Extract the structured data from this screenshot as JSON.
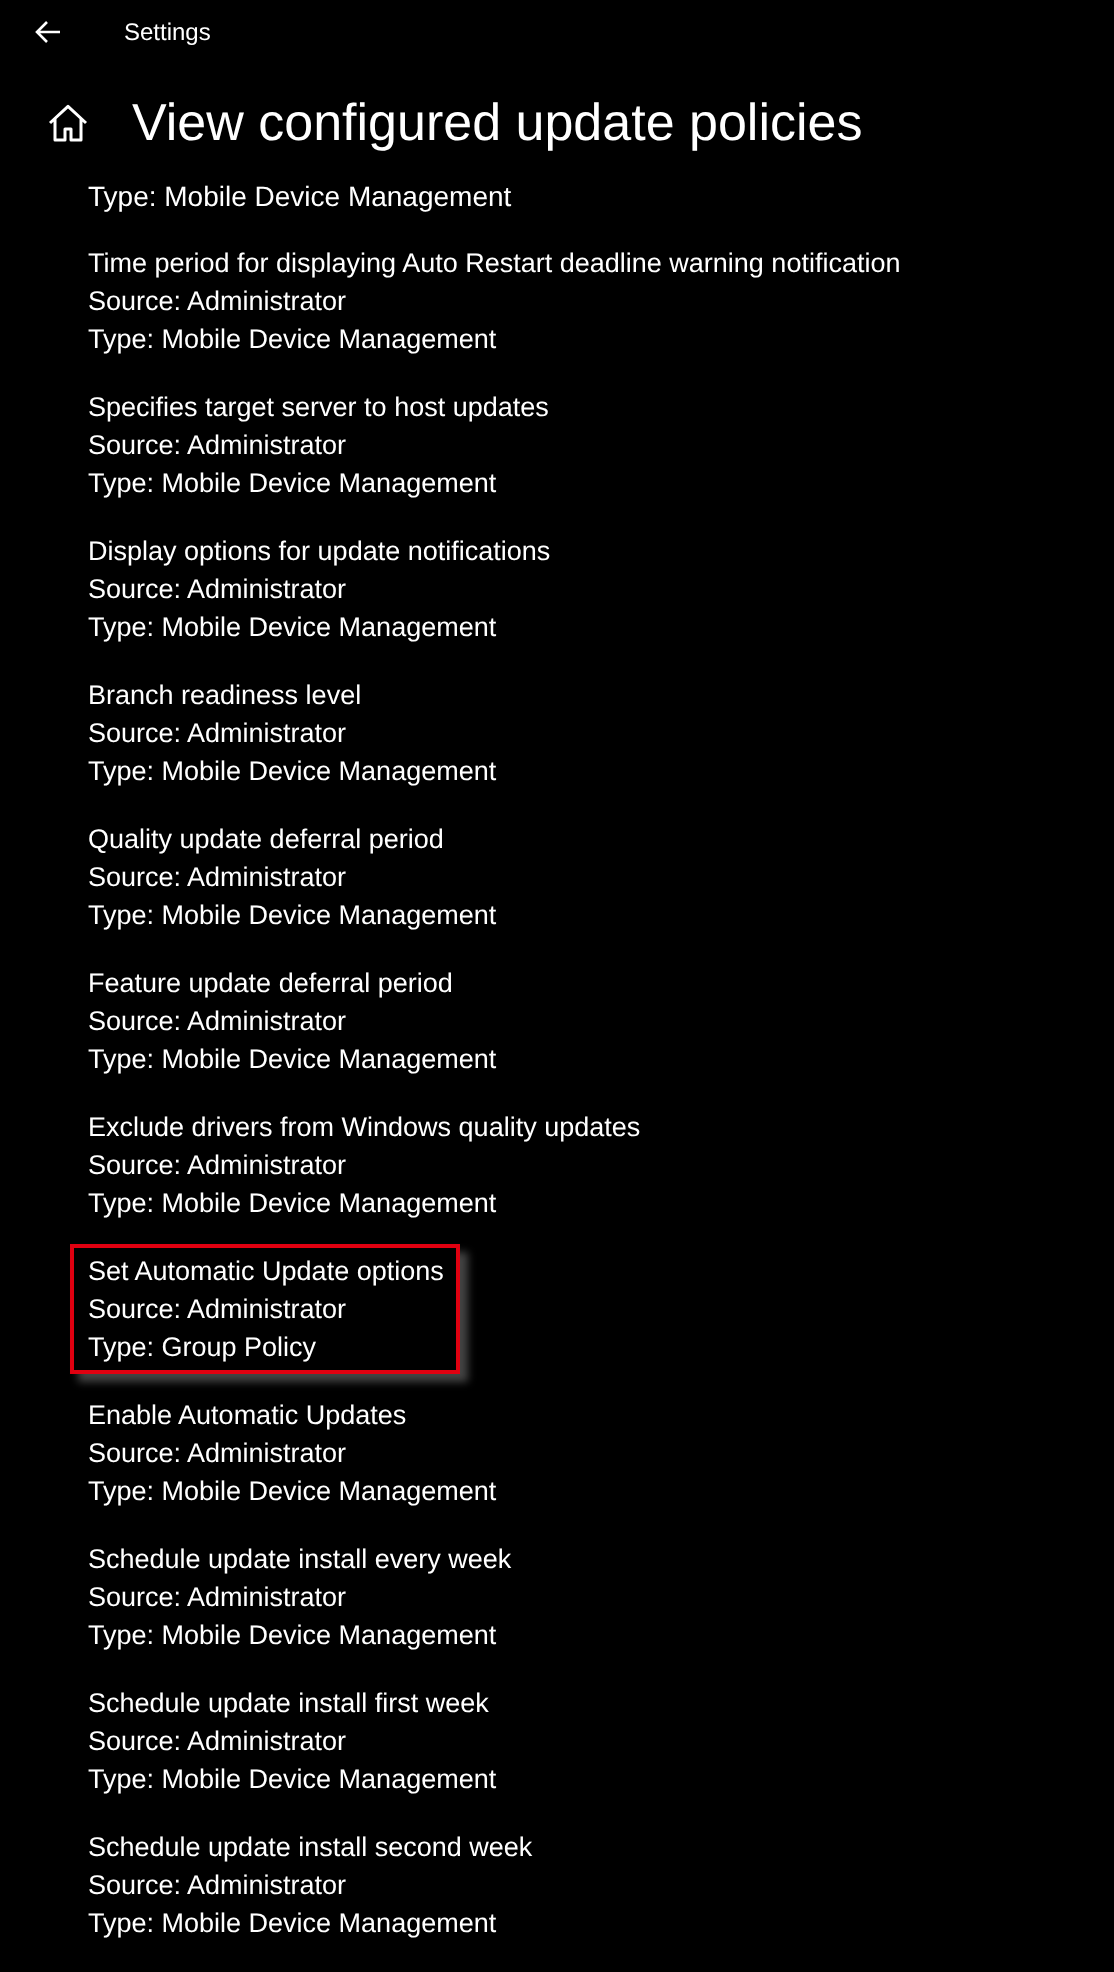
{
  "window": {
    "title": "Settings"
  },
  "page": {
    "title": "View configured update policies"
  },
  "partial_line": "Type: Mobile Device Management",
  "policies": [
    {
      "name": "Time period for displaying Auto Restart deadline warning notification",
      "source": "Source: Administrator",
      "type": "Type: Mobile Device Management",
      "highlighted": false
    },
    {
      "name": "Specifies target server to host updates",
      "source": "Source: Administrator",
      "type": "Type: Mobile Device Management",
      "highlighted": false
    },
    {
      "name": "Display options for update notifications",
      "source": "Source: Administrator",
      "type": "Type: Mobile Device Management",
      "highlighted": false
    },
    {
      "name": "Branch readiness level",
      "source": "Source: Administrator",
      "type": "Type: Mobile Device Management",
      "highlighted": false
    },
    {
      "name": "Quality update deferral period",
      "source": "Source: Administrator",
      "type": "Type: Mobile Device Management",
      "highlighted": false
    },
    {
      "name": "Feature update deferral period",
      "source": "Source: Administrator",
      "type": "Type: Mobile Device Management",
      "highlighted": false
    },
    {
      "name": "Exclude drivers from Windows quality updates",
      "source": "Source: Administrator",
      "type": "Type: Mobile Device Management",
      "highlighted": false
    },
    {
      "name": "Set Automatic Update options",
      "source": "Source: Administrator",
      "type": "Type: Group Policy",
      "highlighted": true
    },
    {
      "name": "Enable Automatic Updates",
      "source": "Source: Administrator",
      "type": "Type: Mobile Device Management",
      "highlighted": false
    },
    {
      "name": "Schedule update install every week",
      "source": "Source: Administrator",
      "type": "Type: Mobile Device Management",
      "highlighted": false
    },
    {
      "name": "Schedule update install first week",
      "source": "Source: Administrator",
      "type": "Type: Mobile Device Management",
      "highlighted": false
    },
    {
      "name": "Schedule update install second week",
      "source": "Source: Administrator",
      "type": "Type: Mobile Device Management",
      "highlighted": false
    }
  ]
}
